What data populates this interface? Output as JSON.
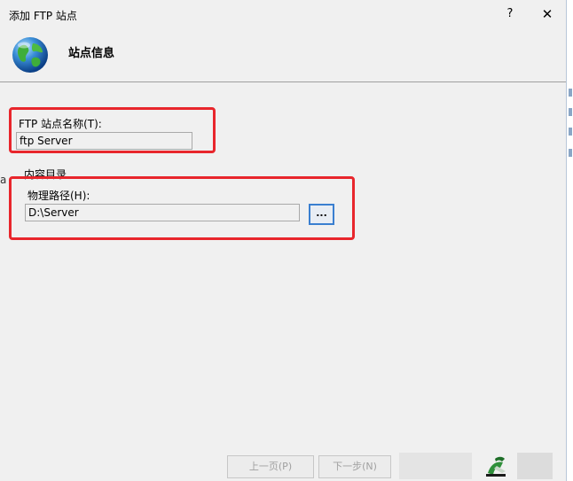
{
  "window": {
    "title": "添加 FTP 站点",
    "help": "?",
    "close": "✕"
  },
  "header": {
    "title": "站点信息",
    "icon": "globe-icon"
  },
  "left_edge": {
    "char": "a"
  },
  "site_name": {
    "label": "FTP 站点名称(T):",
    "value": "ftp Server"
  },
  "content_dir": {
    "section_label": "内容目录",
    "path_label": "物理路径(H):",
    "path_value": "D:\\Server",
    "browse_label": "..."
  },
  "footer": {
    "prev": "上一页(P)",
    "next": "下一步(N)"
  },
  "colors": {
    "highlight": "#e8262c",
    "focus_border": "#3a7fd0",
    "background": "#f0f0f0"
  }
}
